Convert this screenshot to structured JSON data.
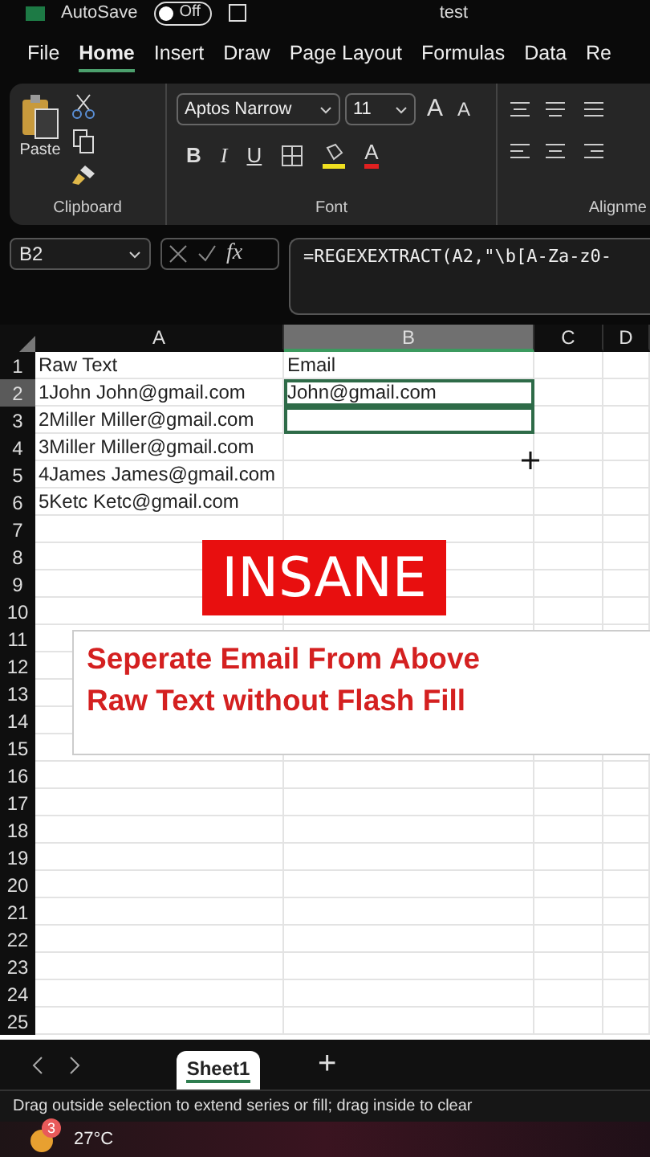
{
  "title_bar": {
    "autosave": "AutoSave",
    "toggle": "Off",
    "toggle_on": false,
    "file": "test"
  },
  "ribbon_tabs": [
    {
      "label": "File",
      "selected": false
    },
    {
      "label": "Home",
      "selected": true
    },
    {
      "label": "Insert",
      "selected": false
    },
    {
      "label": "Draw",
      "selected": false
    },
    {
      "label": "Page Layout",
      "selected": false
    },
    {
      "label": "Formulas",
      "selected": false
    },
    {
      "label": "Data",
      "selected": false
    },
    {
      "label": "Re",
      "selected": false
    }
  ],
  "ribbon": {
    "clipboard": {
      "paste": "Paste",
      "group": "Clipboard"
    },
    "font": {
      "name": "Aptos Narrow",
      "size": "11",
      "grow": "A",
      "shrink": "A",
      "bold": "B",
      "italic": "I",
      "underline": "U",
      "font_color": "A",
      "group": "Font"
    },
    "alignment": {
      "group": "Alignme"
    }
  },
  "formula_bar": {
    "name_box": "B2",
    "fx": "fx",
    "formula": "=REGEXEXTRACT(A2,\"\\b[A-Za-z0-"
  },
  "columns": [
    {
      "label": "A",
      "selected": false
    },
    {
      "label": "B",
      "selected": true
    },
    {
      "label": "C",
      "selected": false
    },
    {
      "label": "D",
      "selected": false
    }
  ],
  "rows": [
    {
      "number": "1",
      "selected": false,
      "cells": [
        {
          "text": "Raw Text",
          "selected": false
        },
        {
          "text": "Email",
          "selected": false
        }
      ]
    },
    {
      "number": "2",
      "selected": true,
      "cells": [
        {
          "text": "1John John@gmail.com",
          "selected": false
        },
        {
          "text": "John@gmail.com",
          "selected": true
        }
      ]
    },
    {
      "number": "3",
      "selected": false,
      "cells": [
        {
          "text": "2Miller Miller@gmail.com",
          "selected": false
        },
        {
          "selected": true
        }
      ]
    },
    {
      "number": "4",
      "selected": false,
      "cells": [
        {
          "text": "3Miller Miller@gmail.com",
          "selected": false
        }
      ]
    },
    {
      "number": "5",
      "selected": false,
      "cells": [
        {
          "text": "4James James@gmail.com",
          "selected": false
        }
      ]
    },
    {
      "number": "6",
      "selected": false,
      "cells": [
        {
          "text": "5Ketc Ketc@gmail.com",
          "selected": false
        }
      ]
    },
    {
      "number": "7",
      "selected": false
    },
    {
      "number": "8",
      "selected": false
    },
    {
      "number": "9",
      "selected": false
    },
    {
      "number": "10",
      "selected": false
    },
    {
      "number": "11",
      "selected": false
    },
    {
      "number": "12",
      "selected": false
    },
    {
      "number": "13",
      "selected": false
    },
    {
      "number": "14",
      "selected": false
    },
    {
      "number": "15",
      "selected": false
    },
    {
      "number": "16",
      "selected": false
    },
    {
      "number": "17",
      "selected": false
    },
    {
      "number": "18",
      "selected": false
    },
    {
      "number": "19",
      "selected": false
    },
    {
      "number": "20",
      "selected": false
    },
    {
      "number": "21",
      "selected": false
    },
    {
      "number": "22",
      "selected": false
    },
    {
      "number": "23",
      "selected": false
    },
    {
      "number": "24",
      "selected": false
    },
    {
      "number": "25",
      "selected": false
    }
  ],
  "banner": {
    "text": "INSANE"
  },
  "caption": {
    "lines": [
      "Seperate Email From Above",
      "Raw Text without Flash Fill"
    ]
  },
  "sheet_tabs": [
    {
      "label": "Sheet1",
      "selected": true
    }
  ],
  "add_sheet": "+",
  "status_bar": "Drag outside selection to extend series or fill; drag inside to clear",
  "taskbar": {
    "badge": "3",
    "temperature": "27°C"
  }
}
